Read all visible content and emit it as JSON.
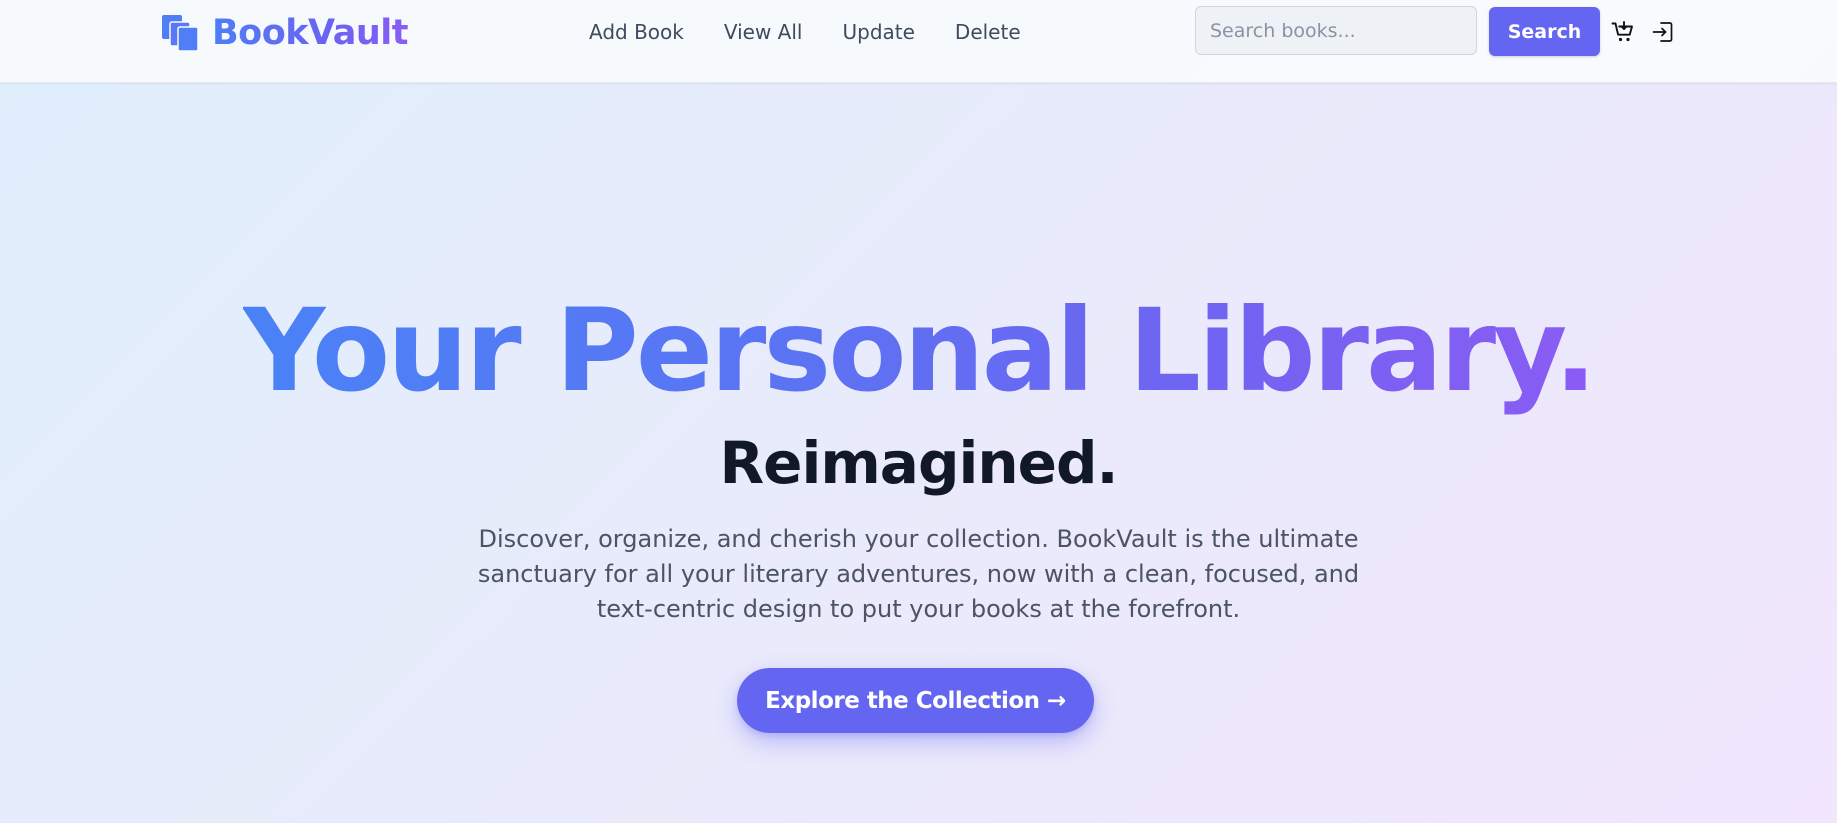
{
  "app": {
    "name": "BookVault",
    "brand_gradient": [
      "#4f7ef7",
      "#8b5cf6"
    ],
    "accent_color": "#6466f1",
    "logo_icon": "stacked-books-icon"
  },
  "nav": {
    "links": [
      {
        "label": "Add Book"
      },
      {
        "label": "View All"
      },
      {
        "label": "Update"
      },
      {
        "label": "Delete"
      }
    ]
  },
  "search": {
    "placeholder": "Search books...",
    "value": "",
    "button_label": "Search"
  },
  "header_icons": [
    {
      "name": "cart-icon"
    },
    {
      "name": "login-icon"
    }
  ],
  "hero": {
    "title": "Your Personal Library.",
    "subtitle": "Reimagined.",
    "description": "Discover, organize, and cherish your collection. BookVault is the ultimate sanctuary for all your literary adventures, now with a clean, focused, and text-centric design to put your books at the forefront.",
    "cta_label": "Explore the Collection →",
    "title_gradient": [
      "#4a82f6",
      "#8a5cf4"
    ],
    "subtitle_color": "#111827"
  }
}
